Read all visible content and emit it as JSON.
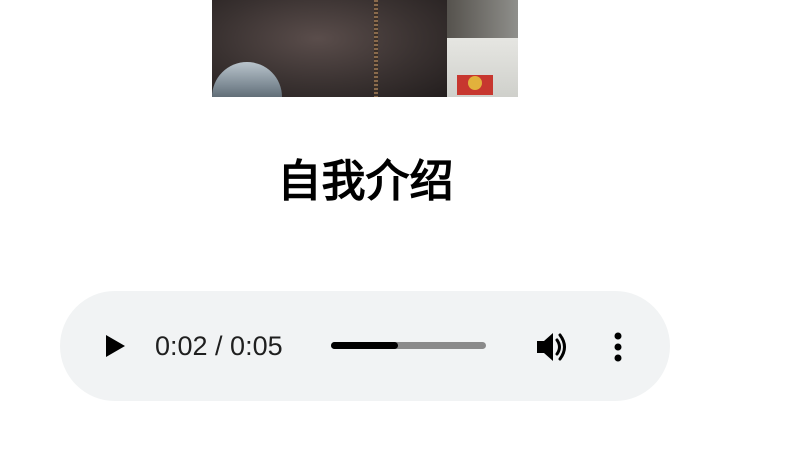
{
  "page": {
    "heading": "自我介绍"
  },
  "media": {
    "image_icon": "photo-image"
  },
  "audio_player": {
    "time_display": "0:02 / 0:05",
    "progress_fraction": 0.43,
    "play_icon": "play-icon",
    "volume_icon": "volume-icon",
    "menu_icon": "more-vert-icon",
    "background_color": "#f1f3f4"
  }
}
